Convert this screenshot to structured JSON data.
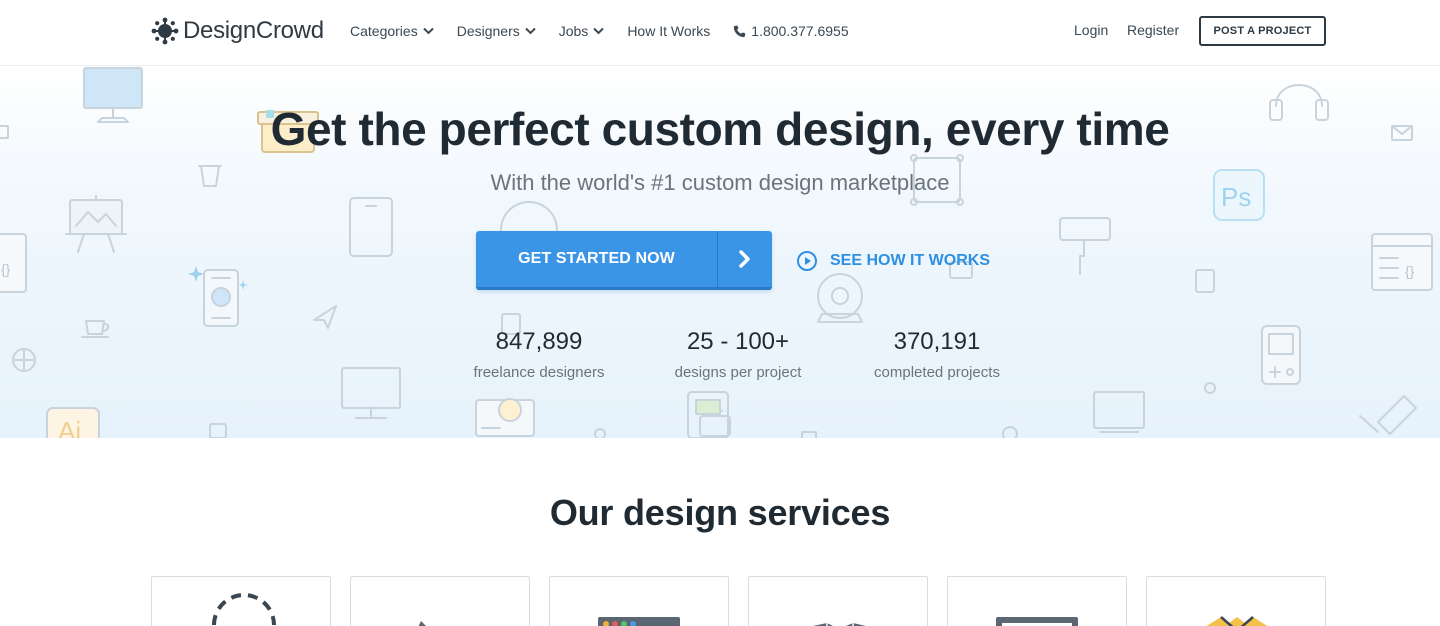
{
  "header": {
    "brand": "DesignCrowd",
    "nav": [
      {
        "label": "Categories",
        "has_dropdown": true
      },
      {
        "label": "Designers",
        "has_dropdown": true
      },
      {
        "label": "Jobs",
        "has_dropdown": true
      },
      {
        "label": "How It Works",
        "has_dropdown": false
      }
    ],
    "phone": "1.800.377.6955",
    "login": "Login",
    "register": "Register",
    "post_project": "POST A PROJECT"
  },
  "hero": {
    "title": "Get the perfect custom design, every time",
    "subtitle": "With the world's #1 custom design marketplace",
    "cta_label": "GET STARTED NOW",
    "secondary_cta": "SEE HOW IT WORKS",
    "stats": [
      {
        "value": "847,899",
        "label": "freelance designers"
      },
      {
        "value": "25 - 100+",
        "label": "designs per project"
      },
      {
        "value": "370,191",
        "label": "completed projects"
      }
    ]
  },
  "services": {
    "title": "Our design services"
  },
  "colors": {
    "accent": "#3b95e6",
    "accent_dark": "#2a79c4",
    "link": "#2f8fe0",
    "text": "#1f2a33",
    "muted": "#6a747c",
    "icon_line": "#c9d3dc"
  },
  "icons": {
    "logo": "splat-logo-icon",
    "dropdown": "chevron-down-icon",
    "phone": "phone-icon",
    "cta": "chevron-right-icon",
    "play": "play-circle-icon"
  }
}
